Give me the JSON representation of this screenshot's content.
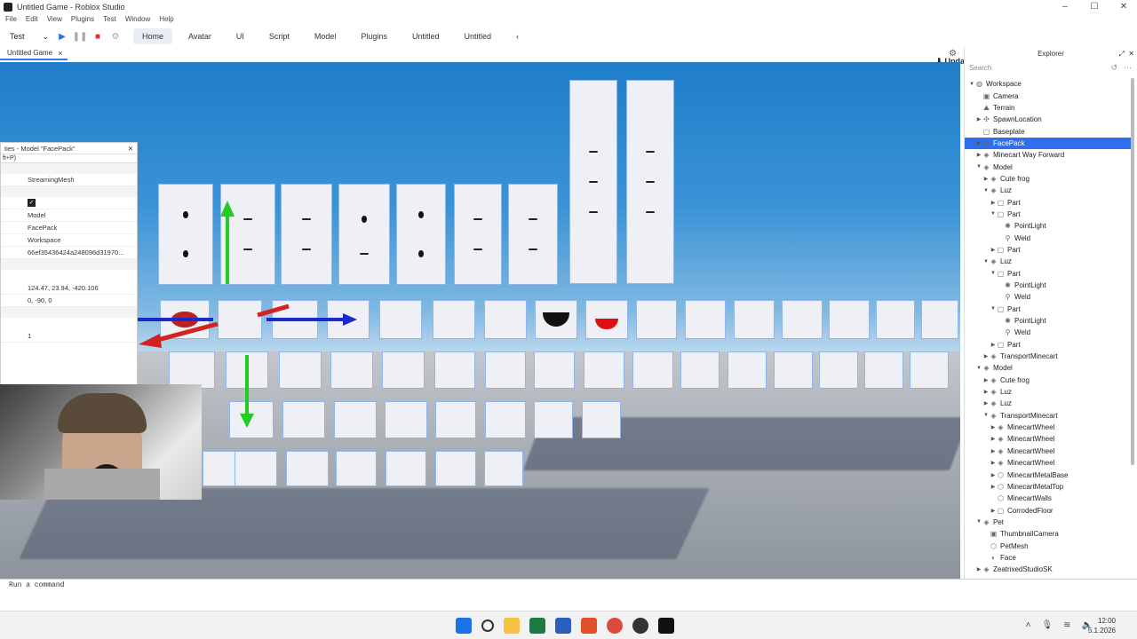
{
  "window": {
    "title": "Untitled Game - Roblox Studio"
  },
  "menu": [
    "File",
    "Edit",
    "View",
    "Plugins",
    "Test",
    "Window",
    "Help"
  ],
  "toolbar": {
    "mode": "Test",
    "tabs": [
      "Home",
      "Avatar",
      "UI",
      "Script",
      "Model",
      "Plugins",
      "Untitled",
      "Untitled"
    ],
    "active_tab": "Home",
    "update_label": "Update"
  },
  "doc_tab": {
    "label": "Untitled Game"
  },
  "properties": {
    "title": "ties - Model \"FacePack\"",
    "filter": "ft+P)",
    "rows": [
      "StreamingMesh",
      "Model",
      "FacePack",
      "Workspace",
      "66ef35436424a248096d31970..."
    ],
    "position": "124.47, 23.94, -420.106",
    "rotation": "0, -90, 0",
    "extra": "1"
  },
  "explorer": {
    "title": "Explorer",
    "search_placeholder": "Search",
    "nodes": [
      {
        "label": "Workspace",
        "depth": 0,
        "arrow": "open",
        "icon": "globe-icon"
      },
      {
        "label": "Camera",
        "depth": 1,
        "arrow": "",
        "icon": "camera-icon"
      },
      {
        "label": "Terrain",
        "depth": 1,
        "arrow": "",
        "icon": "terrain-icon"
      },
      {
        "label": "SpawnLocation",
        "depth": 1,
        "arrow": "closed",
        "icon": "spawn-icon"
      },
      {
        "label": "Baseplate",
        "depth": 1,
        "arrow": "",
        "icon": "part-icon"
      },
      {
        "label": "FacePack",
        "depth": 1,
        "arrow": "closed",
        "icon": "model-icon",
        "selected": true
      },
      {
        "label": "Minecart Way Forward",
        "depth": 1,
        "arrow": "closed",
        "icon": "model-icon"
      },
      {
        "label": "Model",
        "depth": 1,
        "arrow": "open",
        "icon": "model-icon"
      },
      {
        "label": "Cute frog",
        "depth": 2,
        "arrow": "closed",
        "icon": "model-icon"
      },
      {
        "label": "Luz",
        "depth": 2,
        "arrow": "open",
        "icon": "model-icon"
      },
      {
        "label": "Part",
        "depth": 3,
        "arrow": "closed",
        "icon": "part-icon"
      },
      {
        "label": "Part",
        "depth": 3,
        "arrow": "open",
        "icon": "part-icon"
      },
      {
        "label": "PointLight",
        "depth": 4,
        "arrow": "",
        "icon": "light-icon"
      },
      {
        "label": "Weld",
        "depth": 4,
        "arrow": "",
        "icon": "weld-icon"
      },
      {
        "label": "Part",
        "depth": 3,
        "arrow": "closed",
        "icon": "part-icon"
      },
      {
        "label": "Luz",
        "depth": 2,
        "arrow": "open",
        "icon": "model-icon"
      },
      {
        "label": "Part",
        "depth": 3,
        "arrow": "open",
        "icon": "part-icon"
      },
      {
        "label": "PointLight",
        "depth": 4,
        "arrow": "",
        "icon": "light-icon"
      },
      {
        "label": "Weld",
        "depth": 4,
        "arrow": "",
        "icon": "weld-icon"
      },
      {
        "label": "Part",
        "depth": 3,
        "arrow": "open",
        "icon": "part-icon"
      },
      {
        "label": "PointLight",
        "depth": 4,
        "arrow": "",
        "icon": "light-icon"
      },
      {
        "label": "Weld",
        "depth": 4,
        "arrow": "",
        "icon": "weld-icon"
      },
      {
        "label": "Part",
        "depth": 3,
        "arrow": "closed",
        "icon": "part-icon"
      },
      {
        "label": "TransportMinecart",
        "depth": 2,
        "arrow": "closed",
        "icon": "model-icon"
      },
      {
        "label": "Model",
        "depth": 1,
        "arrow": "open",
        "icon": "model-icon"
      },
      {
        "label": "Cute frog",
        "depth": 2,
        "arrow": "closed",
        "icon": "model-icon"
      },
      {
        "label": "Luz",
        "depth": 2,
        "arrow": "closed",
        "icon": "model-icon"
      },
      {
        "label": "Luz",
        "depth": 2,
        "arrow": "closed",
        "icon": "model-icon"
      },
      {
        "label": "TransportMinecart",
        "depth": 2,
        "arrow": "open",
        "icon": "model-icon"
      },
      {
        "label": "MinecartWheel",
        "depth": 3,
        "arrow": "closed",
        "icon": "model-icon"
      },
      {
        "label": "MinecartWheel",
        "depth": 3,
        "arrow": "closed",
        "icon": "model-icon"
      },
      {
        "label": "MinecartWheel",
        "depth": 3,
        "arrow": "closed",
        "icon": "model-icon"
      },
      {
        "label": "MinecartWheel",
        "depth": 3,
        "arrow": "closed",
        "icon": "model-icon"
      },
      {
        "label": "MinecartMetalBase",
        "depth": 3,
        "arrow": "closed",
        "icon": "mesh-icon"
      },
      {
        "label": "MinecartMetalTop",
        "depth": 3,
        "arrow": "closed",
        "icon": "mesh-icon"
      },
      {
        "label": "MinecartWalls",
        "depth": 3,
        "arrow": "",
        "icon": "mesh-icon"
      },
      {
        "label": "CorrodedFloor",
        "depth": 3,
        "arrow": "closed",
        "icon": "part-icon"
      },
      {
        "label": "Pet",
        "depth": 1,
        "arrow": "open",
        "icon": "model-icon"
      },
      {
        "label": "ThumbnailCamera",
        "depth": 2,
        "arrow": "",
        "icon": "camera-icon"
      },
      {
        "label": "PetMesh",
        "depth": 2,
        "arrow": "",
        "icon": "mesh-icon"
      },
      {
        "label": "Face",
        "depth": 2,
        "arrow": "",
        "icon": "decal-icon"
      },
      {
        "label": "ZeatrixedStudioSK",
        "depth": 1,
        "arrow": "closed",
        "icon": "model-icon"
      }
    ]
  },
  "command_bar": {
    "placeholder": "Run a command"
  },
  "clock": {
    "time": "12:00",
    "date": "5.1.2026"
  },
  "colors": {
    "accent": "#2f6fed",
    "sky": "#3a93d6"
  }
}
